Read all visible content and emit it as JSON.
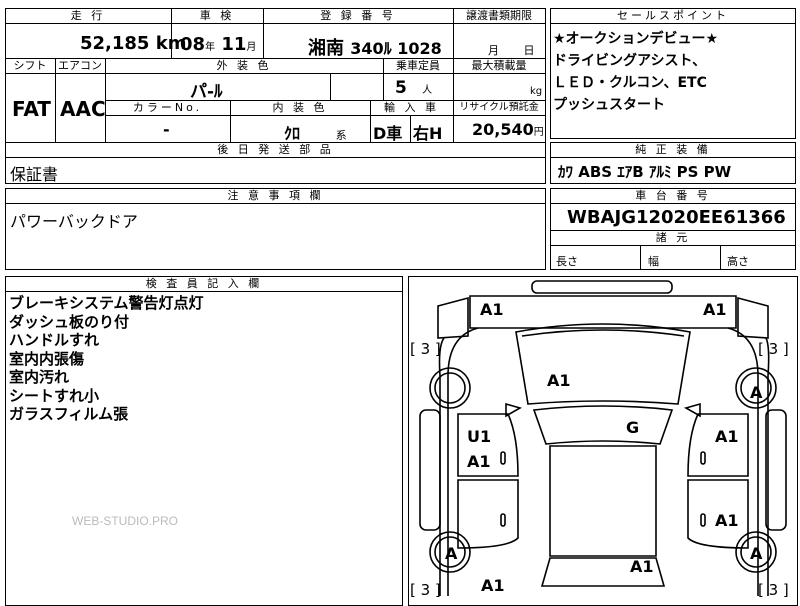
{
  "top_row": {
    "mileage_header": "走 行",
    "inspection_header": "車 検",
    "registration_header": "登 録 番 号",
    "transfer_deadline_header": "譲渡書類期限",
    "selling_points_header": "セールスポイント"
  },
  "mileage": {
    "value": "52,185",
    "unit": "km"
  },
  "inspection": {
    "year": "08",
    "year_unit": "年",
    "month": "11",
    "month_unit": "月"
  },
  "registration": {
    "area": "湘南",
    "number": "340ﾙ 1028"
  },
  "transfer_deadline": {
    "month_unit": "月",
    "day_unit": "日"
  },
  "selling_points": {
    "lines": [
      "★オークションデビュー★",
      "ドライビングアシスト、",
      "ＬＥＤ・クルコン、ETC",
      "プッシュスタート"
    ]
  },
  "second_row": {
    "shift_header": "シフト",
    "aircon_header": "エアコン",
    "exterior_color_header": "外 装 色",
    "capacity_header": "乗車定員",
    "max_load_header": "最大積載量"
  },
  "shift": "FAT",
  "aircon": "AAC",
  "exterior_color": "パ-ﾙ",
  "capacity": {
    "value": "5",
    "unit": "人"
  },
  "max_load": {
    "unit": "kg"
  },
  "third_row": {
    "color_no_header": "カラーNo.",
    "interior_color_header": "内 装 色",
    "import_header": "輸 入 車",
    "recycle_header": "リサイクル預託金"
  },
  "color_no": "-",
  "interior_color": {
    "value": "ｸﾛ",
    "suffix": "系"
  },
  "import": {
    "dealer": "D車",
    "steering": "右H"
  },
  "recycle": {
    "value": "20,540",
    "unit": "円"
  },
  "standard_equipment": {
    "header": "純 正 装 備",
    "value": "ｶﾜ ABS ｴｱB ｱﾙﾐ PS PW"
  },
  "later_parts": {
    "header": "後 日 発 送 部 品",
    "value": "保証書"
  },
  "notes": {
    "header": "注 意 事 項 欄",
    "value": "パワーバックドア"
  },
  "chassis": {
    "header": "車 台 番 号",
    "value": "WBAJG12020EE61366"
  },
  "dimensions": {
    "header": "諸 元",
    "length": "長さ",
    "width": "幅",
    "height": "高さ"
  },
  "inspector": {
    "header": "検 査 員 記 入 欄",
    "lines": [
      "ブレーキシステム警告灯点灯",
      "ダッシュ板のり付",
      "ハンドルすれ",
      "室内内張傷",
      "室内汚れ",
      "シートすれ小",
      "ガラスフィルム張"
    ]
  },
  "watermark": "WEB-STUDIO.PRO",
  "car_diagram": {
    "labels": {
      "front_left": "A1",
      "front_right": "A1",
      "tire_bracket_tl": "[ 3 ]",
      "tire_bracket_tr": "[ 3 ]",
      "tire_bracket_bl": "[ 3 ]",
      "tire_bracket_br": "[ 3 ]",
      "hood": "A1",
      "roof": "G",
      "front_door_left_u": "U1",
      "front_door_left_a": "A1",
      "front_door_right": "A1",
      "rear_door_right": "A1",
      "wheel_fr": "A",
      "wheel_fl": "",
      "wheel_rl": "A",
      "wheel_rr": "A",
      "rear_left": "A1",
      "trunk": "A1"
    }
  }
}
